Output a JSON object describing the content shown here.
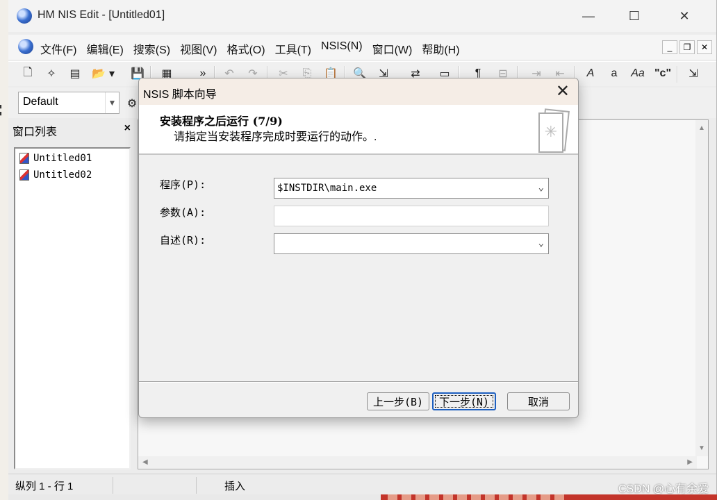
{
  "app": {
    "title": "HM NIS Edit - [Untitled01]",
    "menu": [
      "文件(F)",
      "编辑(E)",
      "搜索(S)",
      "视图(V)",
      "格式(O)",
      "工具(T)",
      "NSIS(N)",
      "窗口(W)",
      "帮助(H)"
    ],
    "style_combo": "Default",
    "window_list_title": "窗口列表",
    "documents": [
      "Untitled01",
      "Untitled02"
    ],
    "status": {
      "position": "纵列 1 - 行 1",
      "mode": "插入"
    }
  },
  "dialog": {
    "title": "NSIS 脚本向导",
    "heading": "安装程序之后运行 (7/9)",
    "subtitle": "请指定当安装程序完成时要运行的动作。.",
    "fields": [
      {
        "label": "程序(P):",
        "value": "$INSTDIR\\main.exe",
        "type": "combo"
      },
      {
        "label": "参数(A):",
        "value": "",
        "type": "text"
      },
      {
        "label": "自述(R):",
        "value": "",
        "type": "combo"
      }
    ],
    "buttons": {
      "back": "上一步(B)",
      "next": "下一步(N)",
      "cancel": "取消"
    }
  },
  "watermark": "CSDN @心有余爱"
}
